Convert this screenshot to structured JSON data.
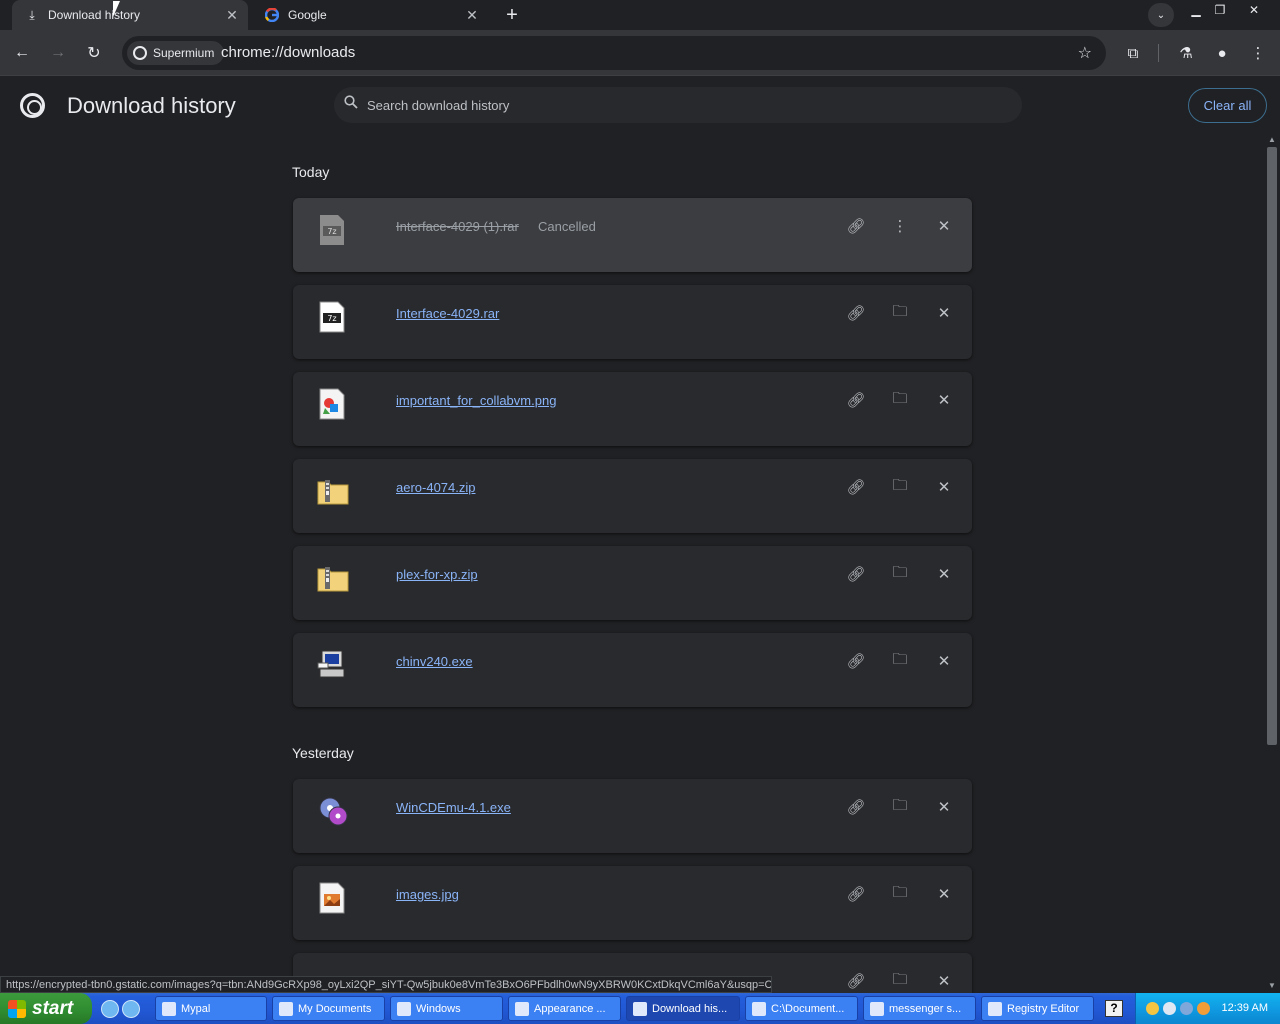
{
  "tabs": [
    {
      "title": "Download history",
      "icon": "download-icon"
    },
    {
      "title": "Google",
      "icon": "google-icon"
    }
  ],
  "toolbar": {
    "site_chip": "Supermium",
    "url": "chrome://downloads"
  },
  "header": {
    "title": "Download history",
    "search_placeholder": "Search download history",
    "clear_all": "Clear all"
  },
  "sections": [
    {
      "label": "Today",
      "items": [
        {
          "name": "Interface-4029 (1).rar",
          "status": "Cancelled",
          "icon": "7z-archive-icon",
          "cancelled": true
        },
        {
          "name": "Interface-4029.rar",
          "icon": "7z-archive-icon"
        },
        {
          "name": "important_for_collabvm.png",
          "icon": "image-file-icon"
        },
        {
          "name": "aero-4074.zip",
          "icon": "zip-folder-icon"
        },
        {
          "name": "plex-for-xp.zip",
          "icon": "zip-folder-icon"
        },
        {
          "name": "chinv240.exe",
          "icon": "installer-icon"
        }
      ]
    },
    {
      "label": "Yesterday",
      "items": [
        {
          "name": "WinCDEmu-4.1.exe",
          "icon": "disc-icon"
        },
        {
          "name": "images.jpg",
          "icon": "jpg-file-icon"
        }
      ]
    }
  ],
  "status_url": "https://encrypted-tbn0.gstatic.com/images?q=tbn:ANd9GcRXp98_oyLxi2QP_siYT-Qw5jbuk0e8VmTe3BxO6PFbdlh0wN9yXBRW0KCxtDkqVCml6aY&usqp=CAU",
  "taskbar": {
    "start_label": "start",
    "buttons": [
      "Mypal",
      "My Documents",
      "Windows",
      "Appearance ...",
      "Download his...",
      "C:\\Document...",
      "messenger s...",
      "Registry Editor"
    ],
    "clock": "12:39 AM"
  }
}
